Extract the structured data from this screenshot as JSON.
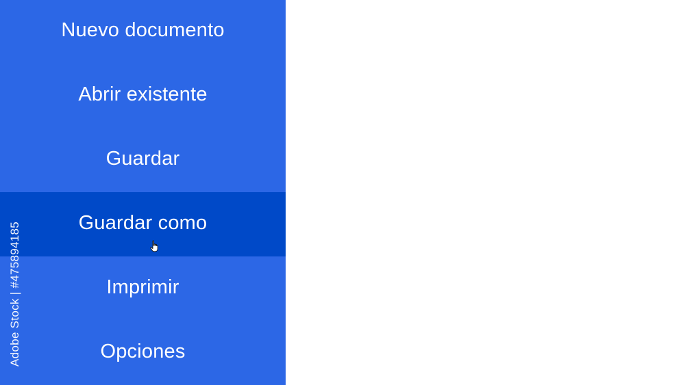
{
  "menu": {
    "items": [
      {
        "label": "Nuevo documento"
      },
      {
        "label": "Abrir existente"
      },
      {
        "label": "Guardar"
      },
      {
        "label": "Guardar como",
        "active": true
      },
      {
        "label": "Imprimir"
      },
      {
        "label": "Opciones"
      }
    ]
  },
  "watermark": {
    "side_text": "Adobe Stock | #475894185"
  },
  "colors": {
    "menu_background": "#2c67e6",
    "menu_active_background": "#0049c8",
    "menu_text": "#ffffff",
    "content_background": "#ffffff"
  },
  "cursor": {
    "icon": "hand-pointer-icon"
  }
}
